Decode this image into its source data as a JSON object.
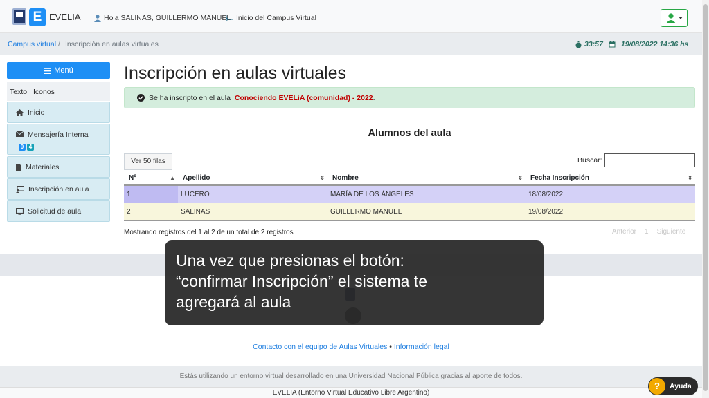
{
  "navbar": {
    "brand": "EVELIA",
    "logo_letter": "E",
    "greeting": "Hola SALINAS, GUILLERMO MANUEL",
    "campus_home": "Inicio del Campus Virtual"
  },
  "breadcrumb": {
    "link": "Campus virtual",
    "separator": "/",
    "current": "Inscripción en aulas virtuales",
    "timer": "33:57",
    "datetime": "19/08/2022 14:36 hs"
  },
  "sidebar": {
    "menu_label": "Menú",
    "mode_text": "Texto",
    "mode_icons": "Iconos",
    "items": [
      {
        "label": "Inicio"
      },
      {
        "label": "Mensajería Interna",
        "badges": [
          "0",
          "4"
        ]
      },
      {
        "label": "Materiales"
      },
      {
        "label": "Inscripción en aula"
      },
      {
        "label": "Solicitud de aula"
      }
    ]
  },
  "main": {
    "title": "Inscripción en aulas virtuales",
    "alert_prefix": "Se ha inscripto en el aula",
    "alert_highlight": "Conociendo EVELiA (comunidad) - 2022",
    "alert_suffix": ".",
    "subtitle": "Alumnos del aula",
    "show_rows": "Ver 50 filas",
    "search_label": "Buscar:",
    "search_value": "",
    "table": {
      "headers": [
        "Nº",
        "Apellido",
        "Nombre",
        "Fecha Inscripción"
      ],
      "rows": [
        [
          "1",
          "LUCERO",
          "MARÍA DE LOS ÁNGELES",
          "18/08/2022"
        ],
        [
          "2",
          "SALINAS",
          "GUILLERMO MANUEL",
          "19/08/2022"
        ]
      ]
    },
    "info": "Mostrando registros del 1 al 2 de un total de 2 registros",
    "pager": {
      "prev": "Anterior",
      "page": "1",
      "next": "Siguiente"
    }
  },
  "footer": {
    "link_contact": "Contacto con el equipo de Aulas Virtuales",
    "link_sep": "•",
    "link_legal": "Información legal",
    "note": "Estás utilizando un entorno virtual desarrollado en una Universidad Nacional Pública gracias al aporte de todos.",
    "bottom": "EVELIA (Entorno Virtual Educativo Libre Argentino)"
  },
  "caption": {
    "line1": "Una vez que presionas el botón:",
    "line2": "“confirmar Inscripción” el sistema te",
    "line3": "agregará al aula"
  },
  "help": {
    "label": "Ayuda",
    "icon_glyph": "?"
  },
  "colors": {
    "accent": "#1e8ff5",
    "success_bg": "#d4eddd",
    "highlight": "#c00000",
    "row1": "#d4d1f7",
    "row2": "#f8f6dc"
  }
}
